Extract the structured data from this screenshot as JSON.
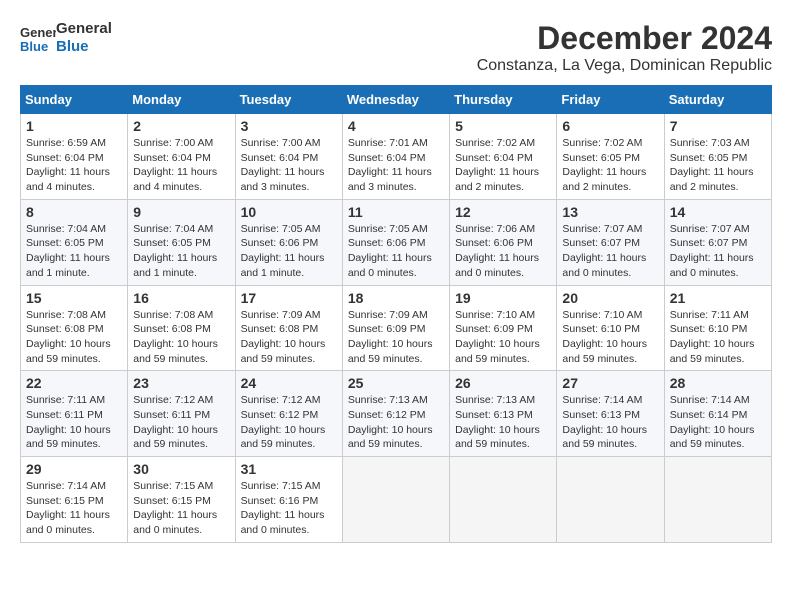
{
  "logo": {
    "general": "General",
    "blue": "Blue"
  },
  "title": {
    "month": "December 2024",
    "location": "Constanza, La Vega, Dominican Republic"
  },
  "weekdays": [
    "Sunday",
    "Monday",
    "Tuesday",
    "Wednesday",
    "Thursday",
    "Friday",
    "Saturday"
  ],
  "weeks": [
    [
      {
        "day": "1",
        "info": "Sunrise: 6:59 AM\nSunset: 6:04 PM\nDaylight: 11 hours and 4 minutes."
      },
      {
        "day": "2",
        "info": "Sunrise: 7:00 AM\nSunset: 6:04 PM\nDaylight: 11 hours and 4 minutes."
      },
      {
        "day": "3",
        "info": "Sunrise: 7:00 AM\nSunset: 6:04 PM\nDaylight: 11 hours and 3 minutes."
      },
      {
        "day": "4",
        "info": "Sunrise: 7:01 AM\nSunset: 6:04 PM\nDaylight: 11 hours and 3 minutes."
      },
      {
        "day": "5",
        "info": "Sunrise: 7:02 AM\nSunset: 6:04 PM\nDaylight: 11 hours and 2 minutes."
      },
      {
        "day": "6",
        "info": "Sunrise: 7:02 AM\nSunset: 6:05 PM\nDaylight: 11 hours and 2 minutes."
      },
      {
        "day": "7",
        "info": "Sunrise: 7:03 AM\nSunset: 6:05 PM\nDaylight: 11 hours and 2 minutes."
      }
    ],
    [
      {
        "day": "8",
        "info": "Sunrise: 7:04 AM\nSunset: 6:05 PM\nDaylight: 11 hours and 1 minute."
      },
      {
        "day": "9",
        "info": "Sunrise: 7:04 AM\nSunset: 6:05 PM\nDaylight: 11 hours and 1 minute."
      },
      {
        "day": "10",
        "info": "Sunrise: 7:05 AM\nSunset: 6:06 PM\nDaylight: 11 hours and 1 minute."
      },
      {
        "day": "11",
        "info": "Sunrise: 7:05 AM\nSunset: 6:06 PM\nDaylight: 11 hours and 0 minutes."
      },
      {
        "day": "12",
        "info": "Sunrise: 7:06 AM\nSunset: 6:06 PM\nDaylight: 11 hours and 0 minutes."
      },
      {
        "day": "13",
        "info": "Sunrise: 7:07 AM\nSunset: 6:07 PM\nDaylight: 11 hours and 0 minutes."
      },
      {
        "day": "14",
        "info": "Sunrise: 7:07 AM\nSunset: 6:07 PM\nDaylight: 11 hours and 0 minutes."
      }
    ],
    [
      {
        "day": "15",
        "info": "Sunrise: 7:08 AM\nSunset: 6:08 PM\nDaylight: 10 hours and 59 minutes."
      },
      {
        "day": "16",
        "info": "Sunrise: 7:08 AM\nSunset: 6:08 PM\nDaylight: 10 hours and 59 minutes."
      },
      {
        "day": "17",
        "info": "Sunrise: 7:09 AM\nSunset: 6:08 PM\nDaylight: 10 hours and 59 minutes."
      },
      {
        "day": "18",
        "info": "Sunrise: 7:09 AM\nSunset: 6:09 PM\nDaylight: 10 hours and 59 minutes."
      },
      {
        "day": "19",
        "info": "Sunrise: 7:10 AM\nSunset: 6:09 PM\nDaylight: 10 hours and 59 minutes."
      },
      {
        "day": "20",
        "info": "Sunrise: 7:10 AM\nSunset: 6:10 PM\nDaylight: 10 hours and 59 minutes."
      },
      {
        "day": "21",
        "info": "Sunrise: 7:11 AM\nSunset: 6:10 PM\nDaylight: 10 hours and 59 minutes."
      }
    ],
    [
      {
        "day": "22",
        "info": "Sunrise: 7:11 AM\nSunset: 6:11 PM\nDaylight: 10 hours and 59 minutes."
      },
      {
        "day": "23",
        "info": "Sunrise: 7:12 AM\nSunset: 6:11 PM\nDaylight: 10 hours and 59 minutes."
      },
      {
        "day": "24",
        "info": "Sunrise: 7:12 AM\nSunset: 6:12 PM\nDaylight: 10 hours and 59 minutes."
      },
      {
        "day": "25",
        "info": "Sunrise: 7:13 AM\nSunset: 6:12 PM\nDaylight: 10 hours and 59 minutes."
      },
      {
        "day": "26",
        "info": "Sunrise: 7:13 AM\nSunset: 6:13 PM\nDaylight: 10 hours and 59 minutes."
      },
      {
        "day": "27",
        "info": "Sunrise: 7:14 AM\nSunset: 6:13 PM\nDaylight: 10 hours and 59 minutes."
      },
      {
        "day": "28",
        "info": "Sunrise: 7:14 AM\nSunset: 6:14 PM\nDaylight: 10 hours and 59 minutes."
      }
    ],
    [
      {
        "day": "29",
        "info": "Sunrise: 7:14 AM\nSunset: 6:15 PM\nDaylight: 11 hours and 0 minutes."
      },
      {
        "day": "30",
        "info": "Sunrise: 7:15 AM\nSunset: 6:15 PM\nDaylight: 11 hours and 0 minutes."
      },
      {
        "day": "31",
        "info": "Sunrise: 7:15 AM\nSunset: 6:16 PM\nDaylight: 11 hours and 0 minutes."
      },
      {
        "day": "",
        "info": ""
      },
      {
        "day": "",
        "info": ""
      },
      {
        "day": "",
        "info": ""
      },
      {
        "day": "",
        "info": ""
      }
    ]
  ]
}
